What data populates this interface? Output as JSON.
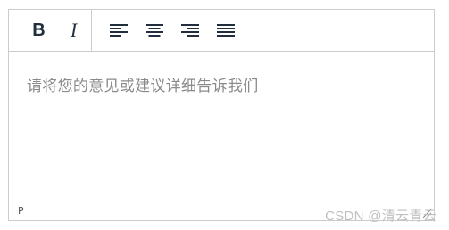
{
  "toolbar": {
    "format_buttons": [
      {
        "icon": "bold-icon",
        "label": "B"
      },
      {
        "icon": "italic-icon",
        "label": "I"
      }
    ],
    "align_buttons": [
      {
        "icon": "align-left-icon"
      },
      {
        "icon": "align-center-icon"
      },
      {
        "icon": "align-right-icon"
      },
      {
        "icon": "align-justify-icon"
      }
    ]
  },
  "editor": {
    "placeholder": "请将您的意见或建议详细告诉我们"
  },
  "statusbar": {
    "path": "P"
  },
  "watermark": {
    "text": "CSDN @清云青云"
  },
  "colors": {
    "border": "#cccccc",
    "icon": "#222f3e",
    "placeholder": "#8a8a8a"
  }
}
